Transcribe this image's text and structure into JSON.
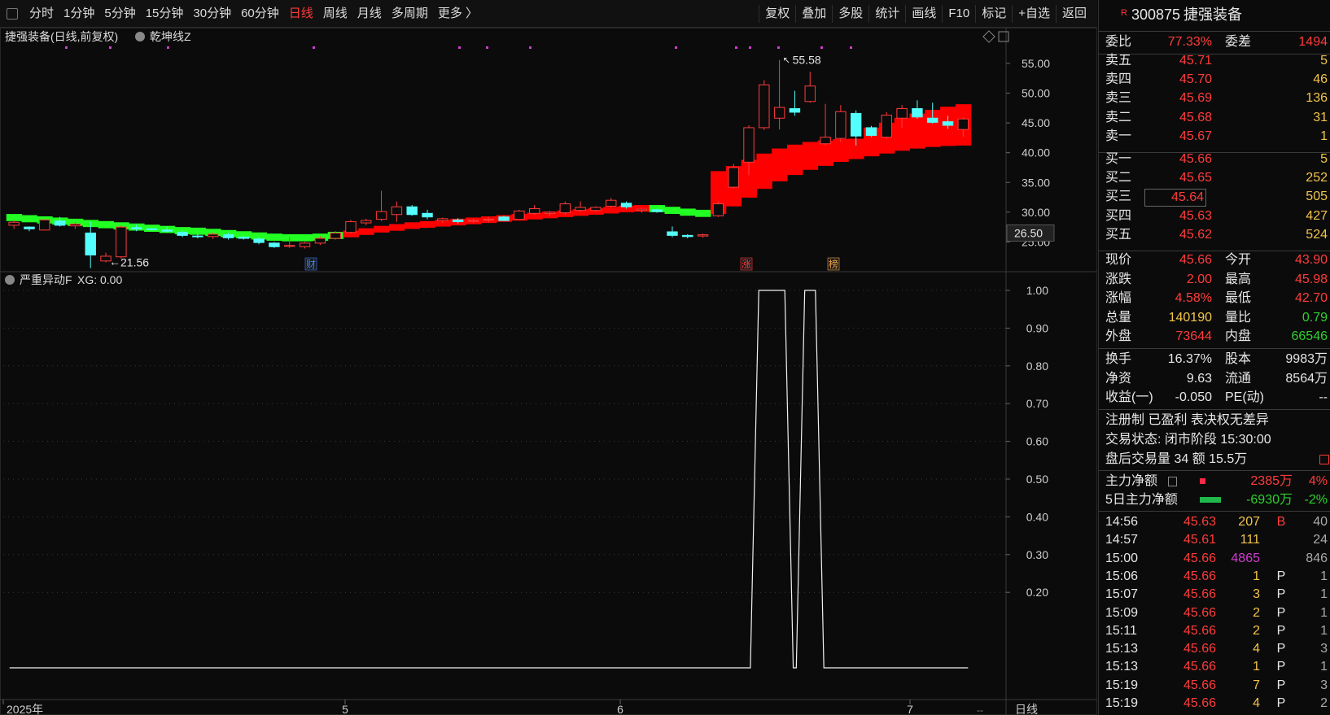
{
  "toolbar": {
    "periods": [
      "分时",
      "1分钟",
      "5分钟",
      "15分钟",
      "30分钟",
      "60分钟",
      "日线",
      "周线",
      "月线",
      "多周期",
      "更多 〉"
    ],
    "active_period": "日线",
    "tools": [
      "复权",
      "叠加",
      "多股",
      "统计",
      "画线",
      "F10",
      "标记",
      "+自选",
      "返回"
    ]
  },
  "chart": {
    "title": "捷强装备(日线,前复权)",
    "indicator": "乾坤线Z",
    "high_label": "55.58",
    "low_label": "21.56",
    "crosshair_value": "26.50",
    "price_ticks": [
      "55.00",
      "50.00",
      "45.00",
      "40.00",
      "35.00",
      "30.00",
      "25.00"
    ],
    "markers": [
      {
        "text": "财",
        "color": "#3b82f6"
      },
      {
        "text": "涨",
        "color": "#ff3b3b"
      },
      {
        "text": "榜",
        "color": "#f2a64a"
      }
    ],
    "sub_title": "严重异动F",
    "sub_value": "XG: 0.00",
    "sub_ticks": [
      "1.00",
      "0.90",
      "0.80",
      "0.70",
      "0.60",
      "0.50",
      "0.40",
      "0.30",
      "0.20"
    ],
    "date_labels": [
      "2025年",
      "5",
      "6",
      "7"
    ],
    "date_right": "日线"
  },
  "chart_data": {
    "type": "candlestick",
    "ylim": [
      20,
      58
    ],
    "candles": [
      [
        27.8,
        28.6,
        27.2,
        28.3
      ],
      [
        27.5,
        27.6,
        26.8,
        27.2
      ],
      [
        27.0,
        28.8,
        26.9,
        28.7
      ],
      [
        28.5,
        29.2,
        27.6,
        27.8
      ],
      [
        27.7,
        28.3,
        27.2,
        28.0
      ],
      [
        26.5,
        28.4,
        20.6,
        22.8
      ],
      [
        21.8,
        23.2,
        21.56,
        22.6
      ],
      [
        22.5,
        27.8,
        22.2,
        27.5
      ],
      [
        27.4,
        27.9,
        26.8,
        27.2
      ],
      [
        27.2,
        27.4,
        26.9,
        27.1
      ],
      [
        27.0,
        27.5,
        26.6,
        26.8
      ],
      [
        26.6,
        26.9,
        25.8,
        26.1
      ],
      [
        26.0,
        26.4,
        25.6,
        25.9
      ],
      [
        25.9,
        26.6,
        25.5,
        26.3
      ],
      [
        26.2,
        26.5,
        25.4,
        25.7
      ],
      [
        25.8,
        26.1,
        25.4,
        25.6
      ],
      [
        25.5,
        25.8,
        24.6,
        24.9
      ],
      [
        24.8,
        25.0,
        24.0,
        24.2
      ],
      [
        24.3,
        25.8,
        24.0,
        24.4
      ],
      [
        24.2,
        25.0,
        23.9,
        24.8
      ],
      [
        24.8,
        26.0,
        24.5,
        25.6
      ],
      [
        25.6,
        26.8,
        25.4,
        26.5
      ],
      [
        26.6,
        28.7,
        26.4,
        28.4
      ],
      [
        28.2,
        28.9,
        27.8,
        28.6
      ],
      [
        28.8,
        33.6,
        28.5,
        30.1
      ],
      [
        29.6,
        31.8,
        28.4,
        30.9
      ],
      [
        30.9,
        31.2,
        29.4,
        29.6
      ],
      [
        29.8,
        30.4,
        28.8,
        29.2
      ],
      [
        28.6,
        29.1,
        28.2,
        28.9
      ],
      [
        28.7,
        29.0,
        28.1,
        28.4
      ],
      [
        28.5,
        28.9,
        28.2,
        28.6
      ],
      [
        28.7,
        29.2,
        28.3,
        28.8
      ],
      [
        29.2,
        29.4,
        28.5,
        28.6
      ],
      [
        28.8,
        30.4,
        28.7,
        30.2
      ],
      [
        29.8,
        31.2,
        29.5,
        30.6
      ],
      [
        29.8,
        30.2,
        29.3,
        30.0
      ],
      [
        29.9,
        31.8,
        29.6,
        31.4
      ],
      [
        30.3,
        31.8,
        30.0,
        30.8
      ],
      [
        30.3,
        31.0,
        30.0,
        30.8
      ],
      [
        31.0,
        32.4,
        30.8,
        32.0
      ],
      [
        31.5,
        31.8,
        30.6,
        30.9
      ],
      [
        30.3,
        30.8,
        29.9,
        30.5
      ],
      [
        30.4,
        30.6,
        29.9,
        30.1
      ],
      [
        26.7,
        27.6,
        25.8,
        26.1
      ],
      [
        26.1,
        26.3,
        25.6,
        25.9
      ],
      [
        26.0,
        26.4,
        25.7,
        26.2
      ],
      [
        29.4,
        31.8,
        29.2,
        31.4
      ],
      [
        34.2,
        38.1,
        34.0,
        37.5
      ],
      [
        38.4,
        44.6,
        36.2,
        44.2
      ],
      [
        44.2,
        52.2,
        43.8,
        51.4
      ],
      [
        45.8,
        55.58,
        43.9,
        47.6
      ],
      [
        47.4,
        50.4,
        46.2,
        46.8
      ],
      [
        48.6,
        53.6,
        48.4,
        51.2
      ],
      [
        41.5,
        48.2,
        41.2,
        42.6
      ],
      [
        42.4,
        48.0,
        41.8,
        46.9
      ],
      [
        46.6,
        47.1,
        41.2,
        42.8
      ],
      [
        44.2,
        44.5,
        42.6,
        42.9
      ],
      [
        42.6,
        46.8,
        42.3,
        46.3
      ],
      [
        45.8,
        48.0,
        44.2,
        47.4
      ],
      [
        47.4,
        48.8,
        45.7,
        46.0
      ],
      [
        45.8,
        48.4,
        44.9,
        45.1
      ],
      [
        45.2,
        46.2,
        44.0,
        44.6
      ],
      [
        43.9,
        45.98,
        42.7,
        45.66
      ]
    ],
    "band": [
      28.8,
      28.6,
      28.4,
      28.2,
      28.0,
      27.8,
      27.6,
      27.4,
      27.2,
      27.0,
      26.8,
      26.6,
      26.5,
      26.3,
      26.1,
      25.9,
      25.7,
      25.5,
      25.4,
      25.4,
      25.5,
      25.8,
      26.2,
      26.6,
      27.0,
      27.3,
      27.6,
      27.8,
      28.0,
      28.2,
      28.4,
      28.6,
      28.8,
      29.0,
      29.2,
      29.4,
      29.6,
      29.8,
      30.0,
      30.2,
      30.4,
      30.5,
      30.3,
      30.0,
      29.7,
      29.5,
      30.2,
      31.6,
      33.2,
      34.8,
      36.2,
      37.4,
      38.4,
      39.2,
      40.0,
      40.6,
      41.2,
      41.8,
      42.4,
      42.9,
      43.3,
      43.6,
      43.8
    ],
    "band_color": [
      "g",
      "g",
      "g",
      "g",
      "g",
      "g",
      "g",
      "g",
      "g",
      "g",
      "g",
      "g",
      "g",
      "g",
      "g",
      "g",
      "g",
      "g",
      "g",
      "g",
      "g",
      "g",
      "r",
      "r",
      "r",
      "r",
      "r",
      "r",
      "r",
      "r",
      "r",
      "r",
      "r",
      "r",
      "r",
      "r",
      "r",
      "r",
      "r",
      "r",
      "r",
      "r",
      "g",
      "g",
      "g",
      "g",
      "r",
      "r",
      "r",
      "r",
      "r",
      "r",
      "r",
      "r",
      "r",
      "r",
      "r",
      "r",
      "r",
      "r",
      "r",
      "r",
      "r"
    ],
    "xg": [
      0,
      0,
      0,
      0,
      0,
      0,
      0,
      0,
      0,
      0,
      0,
      0,
      0,
      0,
      0,
      0,
      0,
      0,
      0,
      0,
      0,
      0,
      0,
      0,
      0,
      0,
      0,
      0,
      0,
      0,
      0,
      0,
      0,
      0,
      0,
      0,
      0,
      0,
      0,
      0,
      0,
      0,
      0,
      0,
      0,
      0,
      0,
      0,
      0,
      1,
      1,
      0,
      1,
      0,
      0,
      0,
      0,
      0,
      0,
      0,
      0,
      0,
      0
    ],
    "sub_ylim": [
      0,
      1.0
    ]
  },
  "quote": {
    "code": "300875",
    "name": "捷强装备",
    "rows_ratio": {
      "label1": "委比",
      "value1": "77.33%",
      "label2": "委差",
      "value2": "1494"
    },
    "asks": [
      {
        "label": "卖五",
        "price": "45.71",
        "vol": "5"
      },
      {
        "label": "卖四",
        "price": "45.70",
        "vol": "46"
      },
      {
        "label": "卖三",
        "price": "45.69",
        "vol": "136"
      },
      {
        "label": "卖二",
        "price": "45.68",
        "vol": "31"
      },
      {
        "label": "卖一",
        "price": "45.67",
        "vol": "1"
      }
    ],
    "bids": [
      {
        "label": "买一",
        "price": "45.66",
        "vol": "5"
      },
      {
        "label": "买二",
        "price": "45.65",
        "vol": "252"
      },
      {
        "label": "买三",
        "price": "45.64",
        "vol": "505"
      },
      {
        "label": "买四",
        "price": "45.63",
        "vol": "427"
      },
      {
        "label": "买五",
        "price": "45.62",
        "vol": "524"
      }
    ],
    "stats": [
      {
        "l1": "现价",
        "v1": "45.66",
        "c1": "red",
        "l2": "今开",
        "v2": "43.90",
        "c2": "red"
      },
      {
        "l1": "涨跌",
        "v1": "2.00",
        "c1": "red",
        "l2": "最高",
        "v2": "45.98",
        "c2": "red"
      },
      {
        "l1": "涨幅",
        "v1": "4.58%",
        "c1": "red",
        "l2": "最低",
        "v2": "42.70",
        "c2": "red"
      },
      {
        "l1": "总量",
        "v1": "140190",
        "c1": "yellow",
        "l2": "量比",
        "v2": "0.79",
        "c2": "green"
      },
      {
        "l1": "外盘",
        "v1": "73644",
        "c1": "red",
        "l2": "内盘",
        "v2": "66546",
        "c2": "green"
      }
    ],
    "stats2": [
      {
        "l1": "换手",
        "v1": "16.37%",
        "l2": "股本",
        "v2": "9983万"
      },
      {
        "l1": "净资",
        "v1": "9.63",
        "l2": "流通",
        "v2": "8564万"
      },
      {
        "l1": "收益(一)",
        "v1": "-0.050",
        "l2": "PE(动)",
        "v2": "--"
      }
    ],
    "info1": "注册制 已盈利 表决权无差异",
    "info2": "交易状态: 闭市阶段 15:30:00",
    "info3": "盘后交易量 34 额 15.5万",
    "flow1": {
      "label": "主力净额",
      "value": "2385万",
      "pct": "4%"
    },
    "flow2": {
      "label": "5日主力净额",
      "value": "-6930万",
      "pct": "-2%"
    },
    "ticks": [
      {
        "t": "14:56",
        "p": "45.63",
        "v": "207",
        "vc": "yellow",
        "f": "B",
        "fc": "red",
        "n": "40"
      },
      {
        "t": "14:57",
        "p": "45.61",
        "v": "111",
        "vc": "yellow",
        "f": "",
        "fc": "white",
        "n": "24"
      },
      {
        "t": "15:00",
        "p": "45.66",
        "v": "4865",
        "vc": "magenta",
        "f": "",
        "fc": "white",
        "n": "846"
      },
      {
        "t": "15:06",
        "p": "45.66",
        "v": "1",
        "vc": "yellow",
        "f": "P",
        "fc": "white",
        "n": "1"
      },
      {
        "t": "15:07",
        "p": "45.66",
        "v": "3",
        "vc": "yellow",
        "f": "P",
        "fc": "white",
        "n": "1"
      },
      {
        "t": "15:09",
        "p": "45.66",
        "v": "2",
        "vc": "yellow",
        "f": "P",
        "fc": "white",
        "n": "1"
      },
      {
        "t": "15:11",
        "p": "45.66",
        "v": "2",
        "vc": "yellow",
        "f": "P",
        "fc": "white",
        "n": "1"
      },
      {
        "t": "15:13",
        "p": "45.66",
        "v": "4",
        "vc": "yellow",
        "f": "P",
        "fc": "white",
        "n": "3"
      },
      {
        "t": "15:13",
        "p": "45.66",
        "v": "1",
        "vc": "yellow",
        "f": "P",
        "fc": "white",
        "n": "1"
      },
      {
        "t": "15:19",
        "p": "45.66",
        "v": "7",
        "vc": "yellow",
        "f": "P",
        "fc": "white",
        "n": "3"
      },
      {
        "t": "15:19",
        "p": "45.66",
        "v": "4",
        "vc": "yellow",
        "f": "P",
        "fc": "white",
        "n": "2"
      }
    ]
  }
}
